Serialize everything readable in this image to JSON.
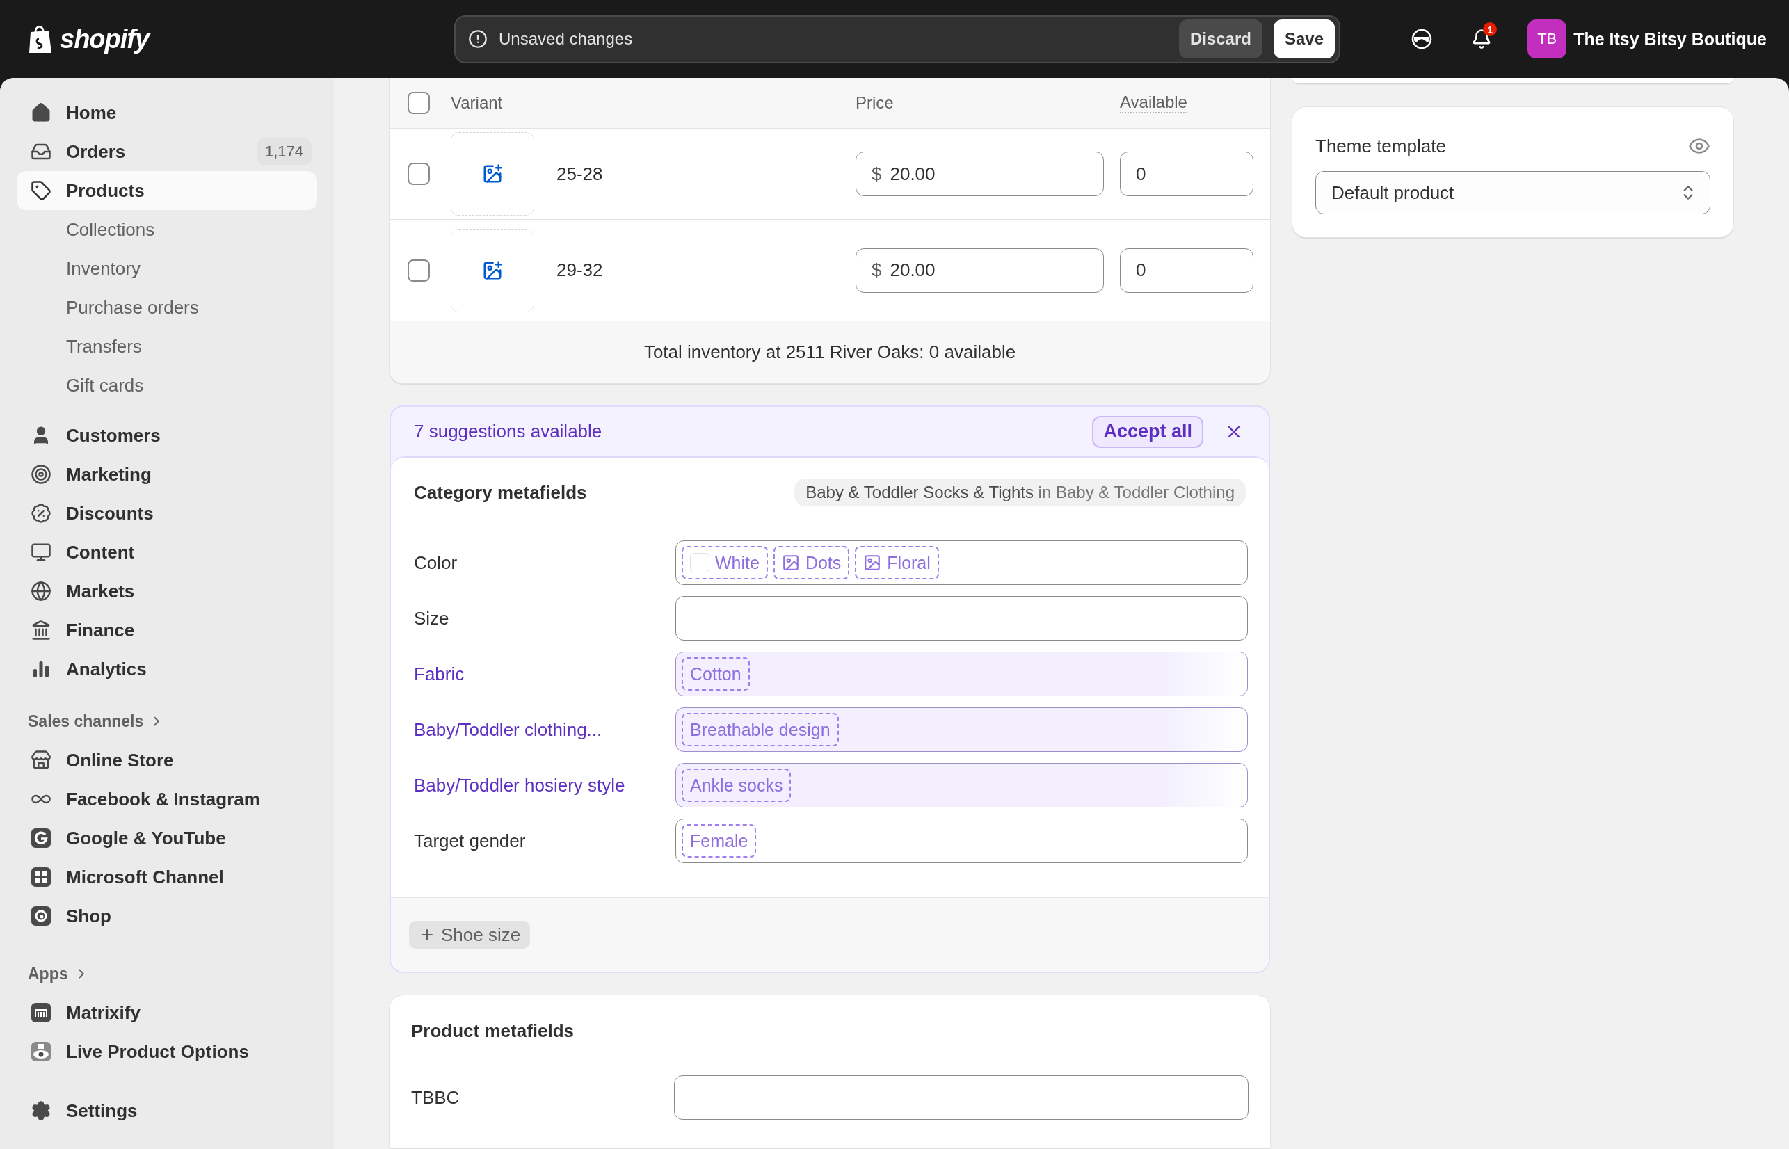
{
  "topbar": {
    "logo": "shopify",
    "unsaved_bar": {
      "message": "Unsaved changes",
      "buttons": [
        {
          "label": "Discard",
          "kind": "secondary"
        },
        {
          "label": "Save",
          "kind": "primary"
        }
      ]
    },
    "notification_count": "1",
    "account": {
      "initials": "TB",
      "name": "The Itsy Bitsy Boutique"
    }
  },
  "sidebar": {
    "items": [
      {
        "label": "Home",
        "selected": false
      },
      {
        "label": "Orders",
        "selected": false,
        "badge": "1,174"
      },
      {
        "label": "Products",
        "selected": true,
        "children": [
          {
            "label": "Collections",
            "selected": false
          },
          {
            "label": "Inventory",
            "selected": false
          },
          {
            "label": "Purchase orders",
            "selected": false
          },
          {
            "label": "Transfers",
            "selected": false
          },
          {
            "label": "Gift cards",
            "selected": false
          }
        ]
      },
      {
        "label": "Customers",
        "selected": false
      },
      {
        "label": "Marketing",
        "selected": false
      },
      {
        "label": "Discounts",
        "selected": false
      },
      {
        "label": "Content",
        "selected": false
      },
      {
        "label": "Markets",
        "selected": false
      },
      {
        "label": "Finance",
        "selected": false
      },
      {
        "label": "Analytics",
        "selected": false
      }
    ],
    "sections": [
      {
        "title": "Sales channels",
        "items": [
          {
            "label": "Online Store",
            "selected": false
          },
          {
            "label": "Facebook & Instagram",
            "selected": false
          },
          {
            "label": "Google & YouTube",
            "selected": false
          },
          {
            "label": "Microsoft Channel",
            "selected": false
          },
          {
            "label": "Shop",
            "selected": false
          }
        ]
      },
      {
        "title": "Apps",
        "items": [
          {
            "label": "Matrixify",
            "selected": false
          },
          {
            "label": "Live Product Options",
            "selected": false
          }
        ]
      }
    ],
    "footer_items": [
      {
        "label": "Settings",
        "selected": false
      }
    ]
  },
  "variants": {
    "header_checked": false,
    "columns": [
      "Variant",
      "Price",
      "Available"
    ],
    "rows": [
      {
        "name": "25-28",
        "checked": false,
        "currency": "$",
        "price": "20.00",
        "available": "0"
      },
      {
        "name": "29-32",
        "checked": false,
        "currency": "$",
        "price": "20.00",
        "available": "0"
      }
    ],
    "footer": "Total inventory at 2511 River Oaks: 0 available"
  },
  "suggestions": {
    "message": "7 suggestions available",
    "accept_label": "Accept all",
    "category_metafields": {
      "title": "Category metafields",
      "category": "Baby & Toddler Socks & Tights",
      "category_context": "in Baby & Toddler Clothing",
      "fields": [
        {
          "label": "Color",
          "suggested": false,
          "values": [
            {
              "text": "White",
              "kind": "swatch",
              "color": "#ffffff"
            },
            {
              "text": "Dots",
              "kind": "image"
            },
            {
              "text": "Floral",
              "kind": "image"
            }
          ]
        },
        {
          "label": "Size",
          "suggested": false
        },
        {
          "label": "Fabric",
          "suggested": true,
          "values": [
            {
              "text": "Cotton",
              "kind": "text"
            }
          ]
        },
        {
          "label": "Baby/Toddler clothing...",
          "suggested": true,
          "values": [
            {
              "text": "Breathable design",
              "kind": "text"
            }
          ]
        },
        {
          "label": "Baby/Toddler hosiery style",
          "suggested": true,
          "values": [
            {
              "text": "Ankle socks",
              "kind": "text"
            }
          ]
        },
        {
          "label": "Target gender",
          "suggested": false,
          "values": [
            {
              "text": "Female",
              "kind": "text"
            }
          ]
        }
      ]
    },
    "add_buttons": [
      "Shoe size"
    ]
  },
  "product_metafields": {
    "title": "Product metafields",
    "fields": [
      {
        "label": "TBBC"
      }
    ]
  },
  "theme_template": {
    "title": "Theme template",
    "value": "Default product"
  }
}
